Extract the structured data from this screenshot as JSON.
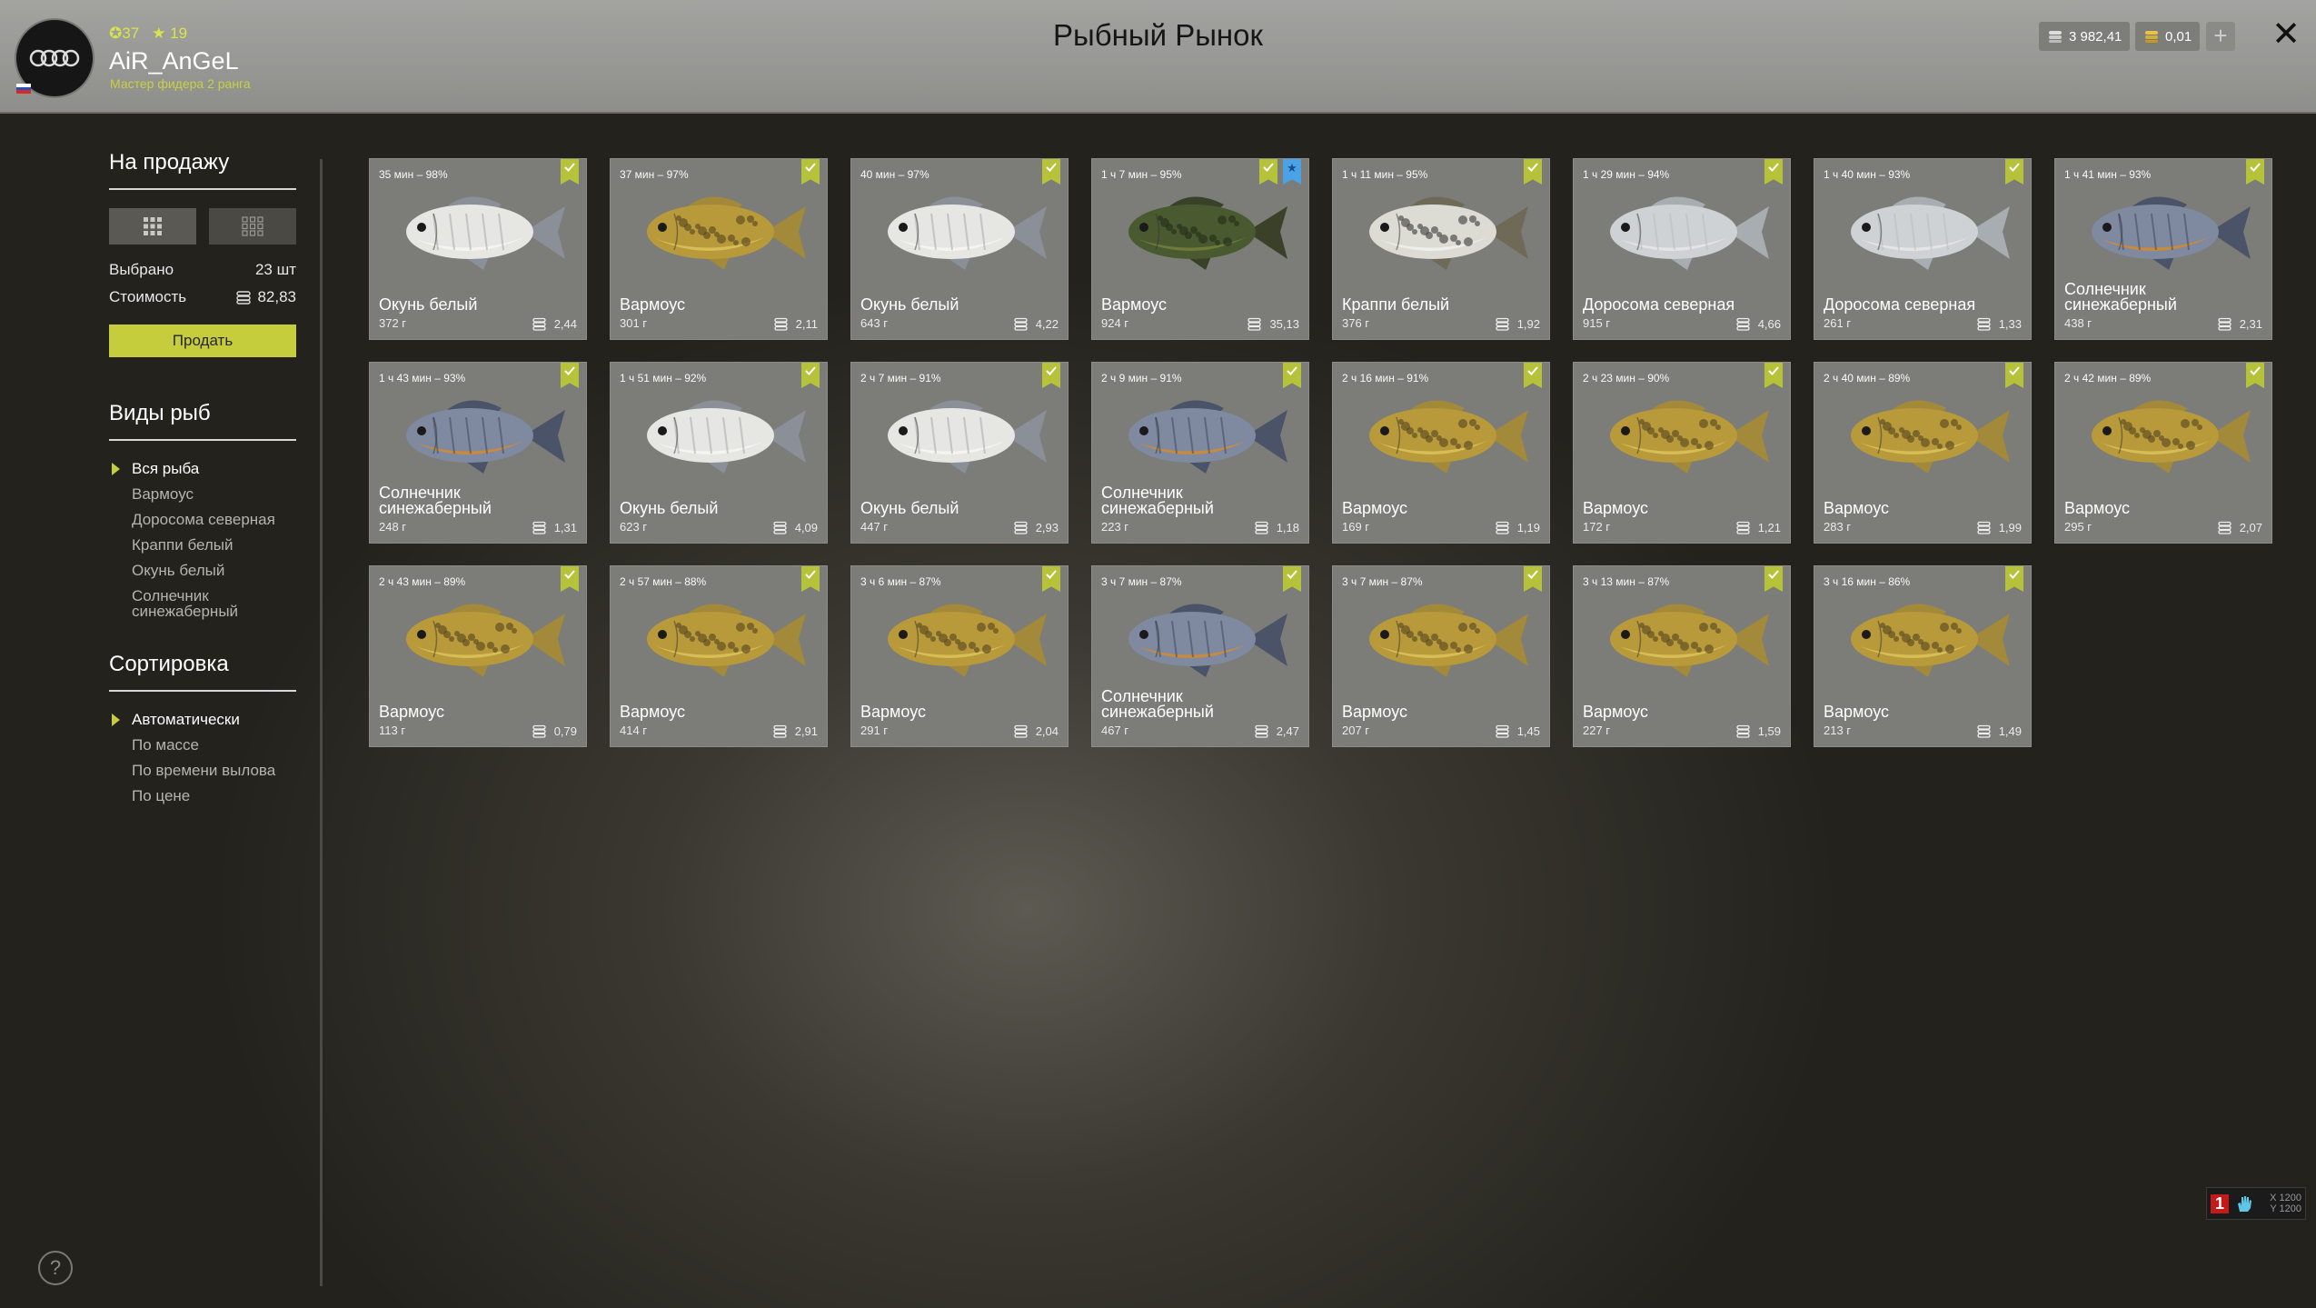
{
  "header": {
    "title": "Рыбный Рынок",
    "username": "AiR_AnGeL",
    "level": "37",
    "rank_number": "19",
    "rank_title": "Мастер фидера 2 ранга",
    "silver": "3 982,41",
    "gold": "0,01",
    "add_label": "+",
    "close_label": "✕"
  },
  "sidebar": {
    "for_sale_title": "На продажу",
    "selected_label": "Выбрано",
    "selected_value": "23 шт",
    "cost_label": "Стоимость",
    "cost_value": "82,83",
    "sell_button": "Продать",
    "fish_types_title": "Виды рыб",
    "fish_types": [
      "Вся рыба",
      "Вармоус",
      "Доросома северная",
      "Краппи белый",
      "Окунь белый",
      "Солнечник синежаберный"
    ],
    "sort_title": "Сортировка",
    "sort_options": [
      "Автоматически",
      "По массе",
      "По времени вылова",
      "По цене"
    ]
  },
  "colors": {
    "accent": "#c5cd3c",
    "check": "#b5c23a",
    "star": "#4aa3e6"
  },
  "cards": [
    {
      "time": "35 мин – 98%",
      "name": "Окунь белый",
      "weight": "372 г",
      "price": "2,44",
      "kind": "bass"
    },
    {
      "time": "37 мин – 97%",
      "name": "Вармоус",
      "weight": "301 г",
      "price": "2,11",
      "kind": "warmouth"
    },
    {
      "time": "40 мин – 97%",
      "name": "Окунь белый",
      "weight": "643 г",
      "price": "4,22",
      "kind": "bass"
    },
    {
      "time": "1 ч 7 мин – 95%",
      "name": "Вармоус",
      "weight": "924 г",
      "price": "35,13",
      "kind": "warmouth_dark",
      "star": true
    },
    {
      "time": "1 ч 11 мин – 95%",
      "name": "Краппи белый",
      "weight": "376 г",
      "price": "1,92",
      "kind": "crappie"
    },
    {
      "time": "1 ч 29 мин – 94%",
      "name": "Доросома северная",
      "weight": "915 г",
      "price": "4,66",
      "kind": "shad"
    },
    {
      "time": "1 ч 40 мин – 93%",
      "name": "Доросома северная",
      "weight": "261 г",
      "price": "1,33",
      "kind": "shad"
    },
    {
      "time": "1 ч 41 мин – 93%",
      "name": "Солнечник синежаберный",
      "weight": "438 г",
      "price": "2,31",
      "kind": "bluegill"
    },
    {
      "time": "1 ч 43 мин – 93%",
      "name": "Солнечник синежаберный",
      "weight": "248 г",
      "price": "1,31",
      "kind": "bluegill"
    },
    {
      "time": "1 ч 51 мин – 92%",
      "name": "Окунь белый",
      "weight": "623 г",
      "price": "4,09",
      "kind": "bass"
    },
    {
      "time": "2 ч 7 мин – 91%",
      "name": "Окунь белый",
      "weight": "447 г",
      "price": "2,93",
      "kind": "bass"
    },
    {
      "time": "2 ч 9 мин – 91%",
      "name": "Солнечник синежаберный",
      "weight": "223 г",
      "price": "1,18",
      "kind": "bluegill"
    },
    {
      "time": "2 ч 16 мин – 91%",
      "name": "Вармоус",
      "weight": "169 г",
      "price": "1,19",
      "kind": "warmouth"
    },
    {
      "time": "2 ч 23 мин – 90%",
      "name": "Вармоус",
      "weight": "172 г",
      "price": "1,21",
      "kind": "warmouth"
    },
    {
      "time": "2 ч 40 мин – 89%",
      "name": "Вармоус",
      "weight": "283 г",
      "price": "1,99",
      "kind": "warmouth"
    },
    {
      "time": "2 ч 42 мин – 89%",
      "name": "Вармоус",
      "weight": "295 г",
      "price": "2,07",
      "kind": "warmouth"
    },
    {
      "time": "2 ч 43 мин – 89%",
      "name": "Вармоус",
      "weight": "113 г",
      "price": "0,79",
      "kind": "warmouth"
    },
    {
      "time": "2 ч 57 мин – 88%",
      "name": "Вармоус",
      "weight": "414 г",
      "price": "2,91",
      "kind": "warmouth"
    },
    {
      "time": "3 ч 6 мин – 87%",
      "name": "Вармоус",
      "weight": "291 г",
      "price": "2,04",
      "kind": "warmouth"
    },
    {
      "time": "3 ч 7 мин – 87%",
      "name": "Солнечник синежаберный",
      "weight": "467 г",
      "price": "2,47",
      "kind": "bluegill"
    },
    {
      "time": "3 ч 7 мин – 87%",
      "name": "Вармоус",
      "weight": "207 г",
      "price": "1,45",
      "kind": "warmouth"
    },
    {
      "time": "3 ч 13 мин – 87%",
      "name": "Вармоус",
      "weight": "227 г",
      "price": "1,59",
      "kind": "warmouth"
    },
    {
      "time": "3 ч 16 мин – 86%",
      "name": "Вармоус",
      "weight": "213 г",
      "price": "1,49",
      "kind": "warmouth"
    }
  ],
  "indicator": {
    "count": "1",
    "x": "X 1200",
    "y": "Y 1200"
  }
}
